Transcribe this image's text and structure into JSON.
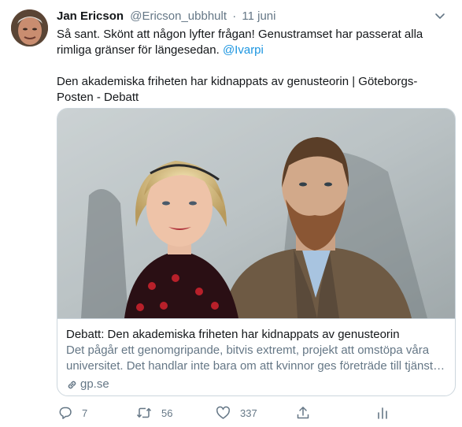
{
  "tweet": {
    "author_name": "Jan Ericson",
    "author_handle": "@Ericson_ubbhult",
    "separator": "·",
    "date": "11 juni",
    "text": "Så sant. Skönt att någon lyfter frågan! Genustramset har passerat alla rimliga gränser för längesedan.",
    "mention": "@Ivarpi",
    "link_text": "Den akademiska friheten har kidnappats av genusteorin | Göteborgs-Posten - Debatt"
  },
  "card": {
    "title": "Debatt: Den akademiska friheten har kidnappats av genusteorin",
    "description": "Det pågår ett genomgripande, bitvis extremt, projekt att omstöpa våra universitet. Det handlar inte bara om att kvinnor ges företräde till tjänst…",
    "domain": "gp.se"
  },
  "actions": {
    "reply_count": "7",
    "retweet_count": "56",
    "like_count": "337"
  },
  "colors": {
    "text": "#14171a",
    "secondary": "#657786",
    "link": "#1b95e0",
    "border": "#ccd6dd"
  },
  "icons": [
    "chevron-down-icon",
    "link-icon",
    "reply-icon",
    "retweet-icon",
    "heart-icon",
    "share-icon",
    "analytics-icon"
  ]
}
